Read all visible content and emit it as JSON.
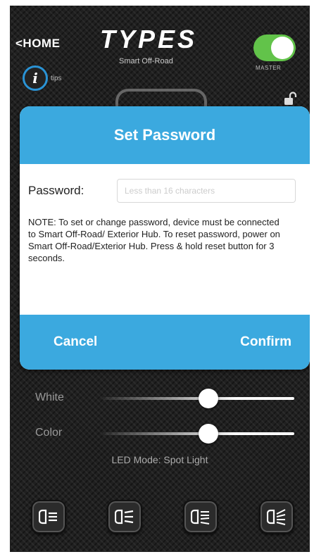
{
  "header": {
    "home_label": "<HOME",
    "logo_text": "TYPES",
    "logo_sub": "Smart Off-Road",
    "master_label": "MASTER",
    "master_on": true,
    "tips_label": "tips",
    "info_glyph": "i"
  },
  "dialog": {
    "title": "Set Password",
    "password_label": "Password:",
    "password_placeholder": "Less than 16 characters",
    "password_value": "",
    "note": "NOTE: To set or change password, device must be connected to Smart Off-Road/ Exterior Hub.  To reset password, power on Smart Off-Road/Exterior Hub. Press & hold reset button for 3 seconds.",
    "cancel_label": "Cancel",
    "confirm_label": "Confirm"
  },
  "sliders": [
    {
      "label": "White",
      "level": 0.55
    },
    {
      "label": "Color",
      "level": 0.55
    }
  ],
  "led_mode": "LED Mode: Spot Light",
  "mode_buttons": [
    {
      "icon": "spot-light-icon"
    },
    {
      "icon": "flood-light-icon"
    },
    {
      "icon": "combo-light-icon"
    },
    {
      "icon": "wide-beam-icon"
    }
  ],
  "colors": {
    "accent_blue": "#3ba9df",
    "toggle_green": "#62c34a",
    "info_ring": "#2a93d5"
  }
}
